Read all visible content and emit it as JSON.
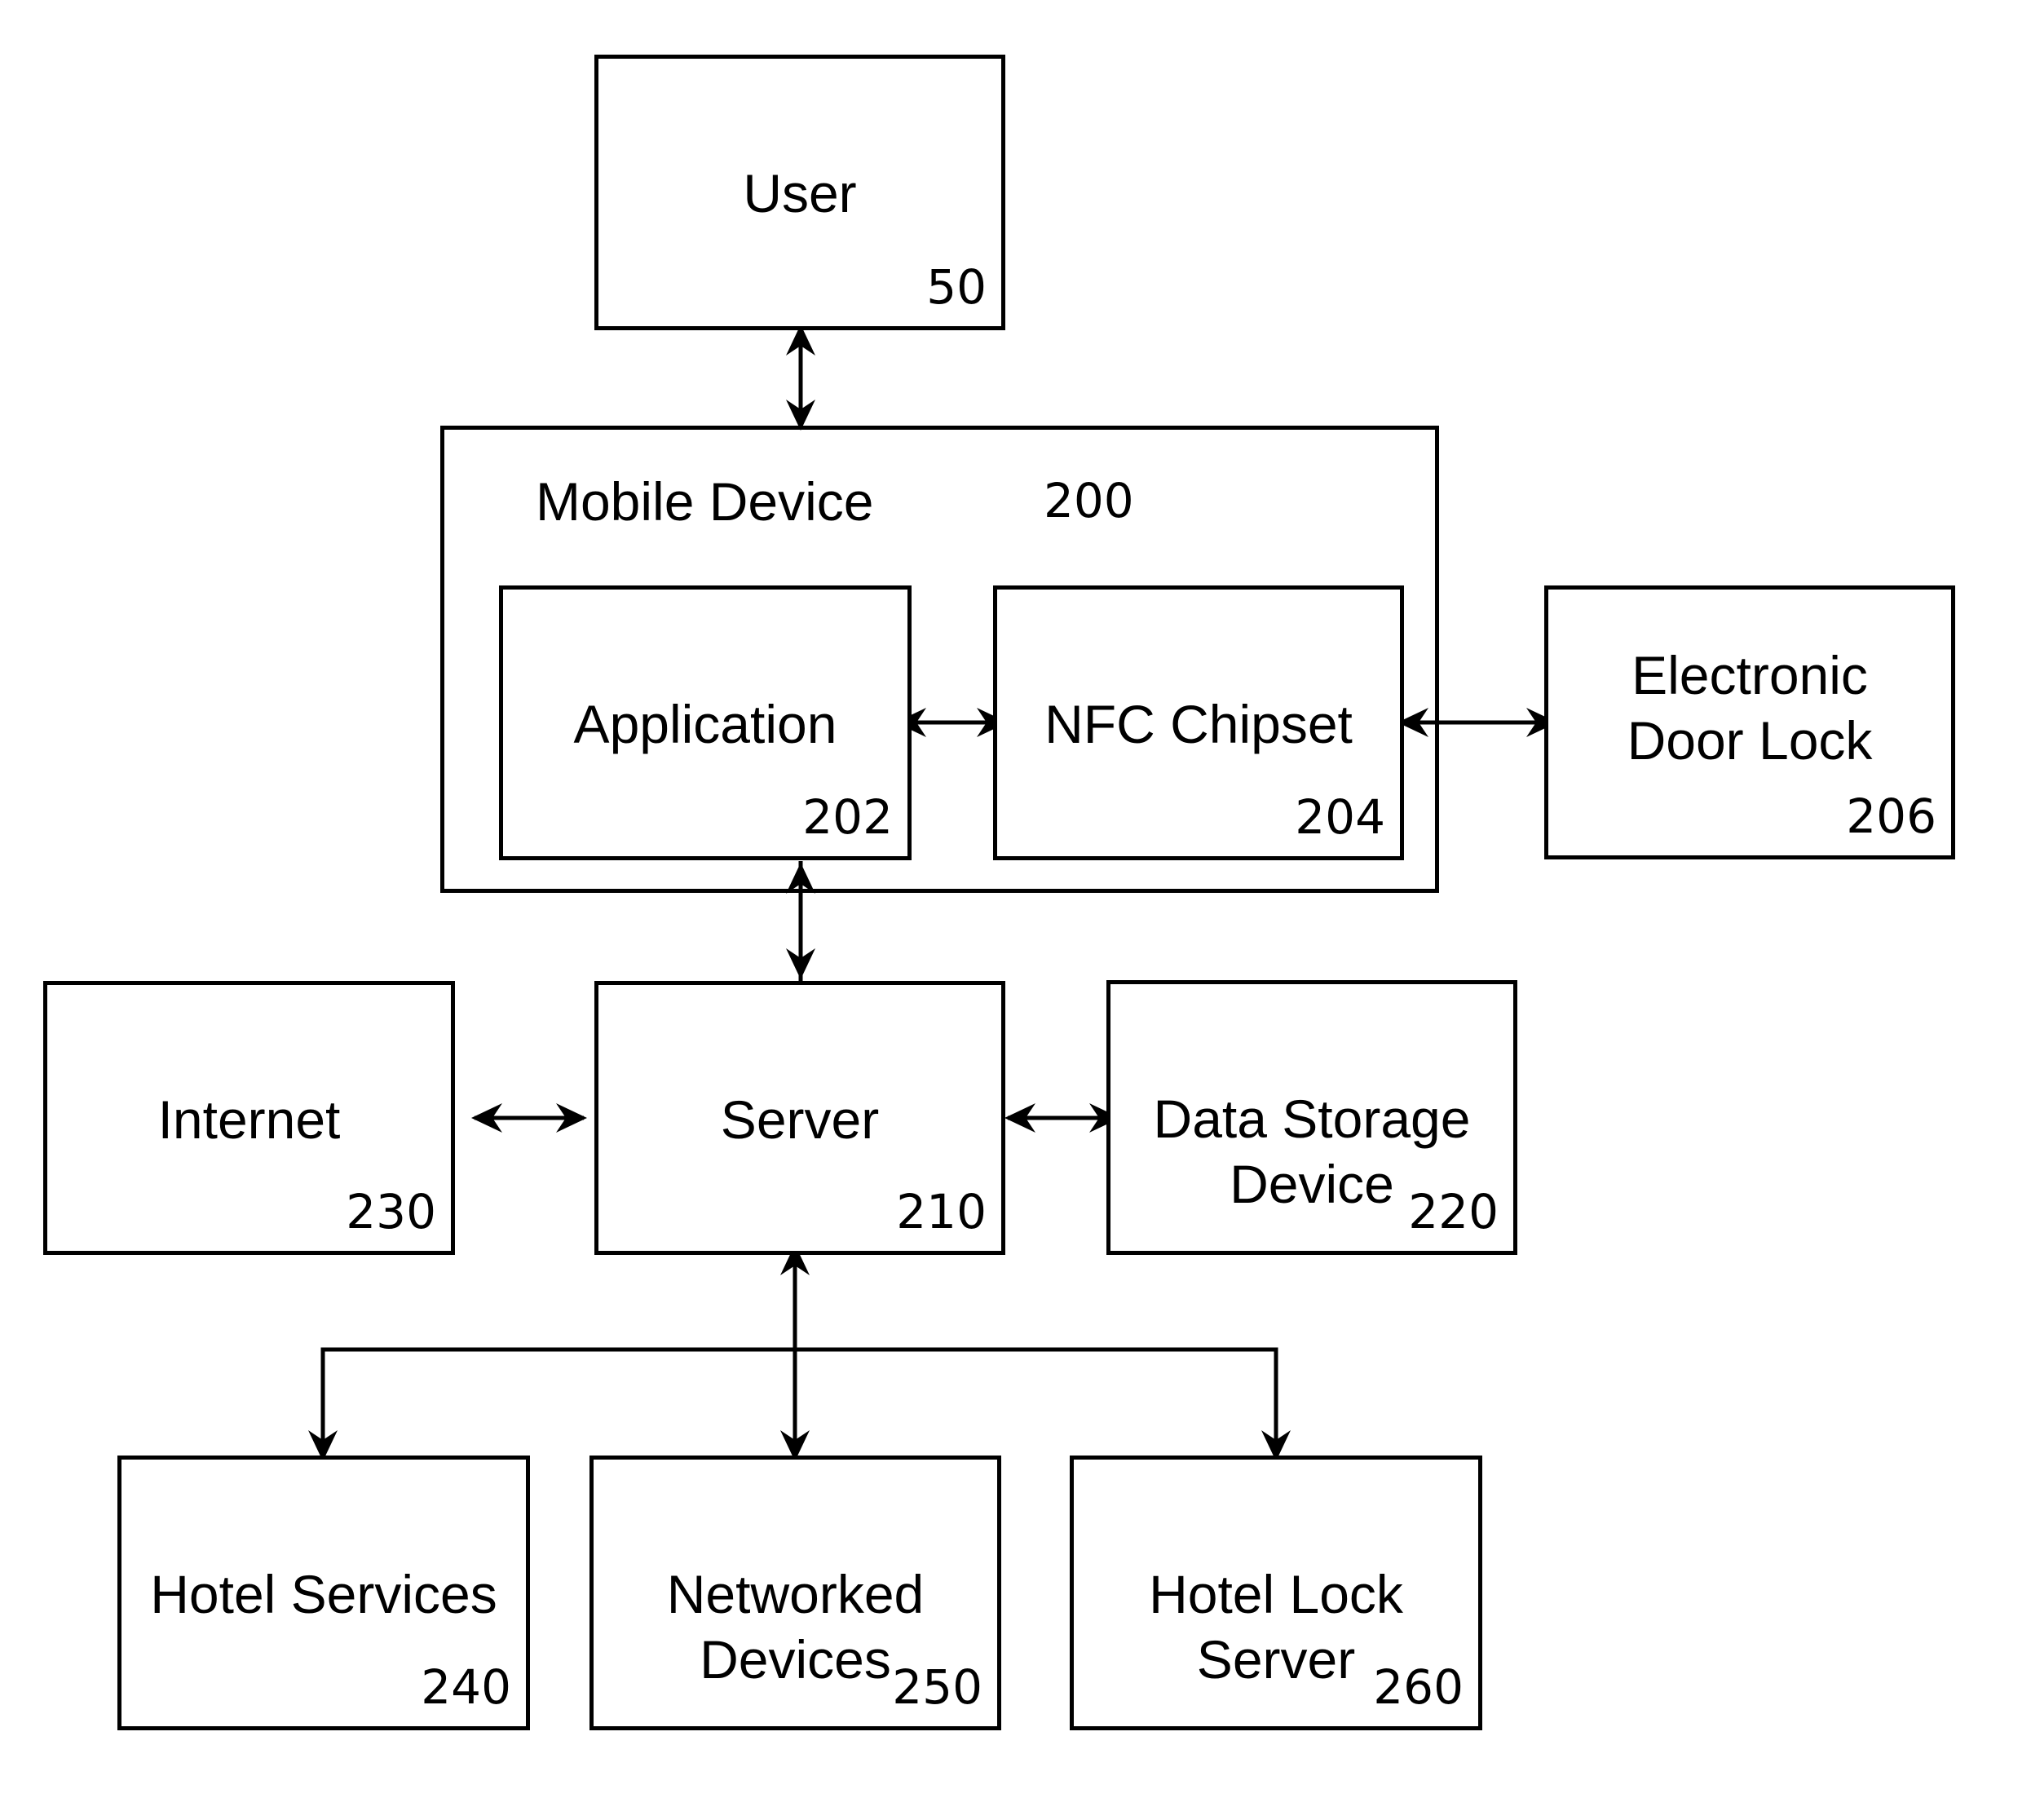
{
  "diagram": {
    "nodes": [
      {
        "id": "user",
        "label": "User",
        "ref": "50"
      },
      {
        "id": "mobile",
        "label": "Mobile Device",
        "ref": "200"
      },
      {
        "id": "application",
        "label": "Application",
        "ref": "202"
      },
      {
        "id": "nfc",
        "label": "NFC Chipset",
        "ref": "204"
      },
      {
        "id": "doorlock",
        "label": "Electronic Door Lock",
        "label_lines": [
          "Electronic",
          "Door Lock"
        ],
        "ref": "206"
      },
      {
        "id": "server",
        "label": "Server",
        "ref": "210"
      },
      {
        "id": "storage",
        "label": "Data Storage Device",
        "label_lines": [
          "Data Storage",
          "Device"
        ],
        "ref": "220"
      },
      {
        "id": "internet",
        "label": "Internet",
        "ref": "230"
      },
      {
        "id": "hotelservices",
        "label": "Hotel Services",
        "ref": "240"
      },
      {
        "id": "networked",
        "label": "Networked Devices",
        "label_lines": [
          "Networked",
          "Devices"
        ],
        "ref": "250"
      },
      {
        "id": "hotellock",
        "label": "Hotel Lock Server",
        "label_lines": [
          "Hotel Lock",
          "Server"
        ],
        "ref": "260"
      }
    ],
    "edges": [
      {
        "from": "user",
        "to": "mobile",
        "direction": "both"
      },
      {
        "from": "application",
        "to": "nfc",
        "direction": "both"
      },
      {
        "from": "nfc",
        "to": "doorlock",
        "direction": "both"
      },
      {
        "from": "application",
        "to": "server",
        "direction": "both"
      },
      {
        "from": "internet",
        "to": "server",
        "direction": "both"
      },
      {
        "from": "server",
        "to": "storage",
        "direction": "both"
      },
      {
        "from": "server",
        "to": "networked",
        "direction": "both"
      },
      {
        "from": "server",
        "to": "hotelservices",
        "direction": "forward"
      },
      {
        "from": "server",
        "to": "hotellock",
        "direction": "forward"
      }
    ]
  }
}
